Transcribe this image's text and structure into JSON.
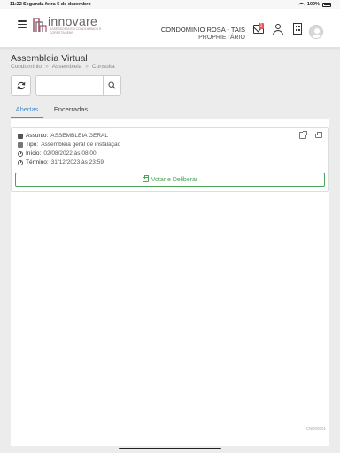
{
  "status_bar": {
    "time": "11:22",
    "date": "Segunda-feira 5 de dezembro",
    "battery": "100%"
  },
  "header": {
    "logo_text": "innovare",
    "logo_tagline": "ASSESSORIA EM CONDOMÍNIOS E CORRETAGENS",
    "condo_name": "CONDOMINIO ROSA - TAIS",
    "role": "PROPRIETÁRIO",
    "mail_badge": "1"
  },
  "page": {
    "title": "Assembleia Virtual",
    "breadcrumb": [
      "Condomínio",
      "Assembleia",
      "Consulta"
    ]
  },
  "search": {
    "value": "",
    "placeholder": ""
  },
  "tabs": [
    {
      "label": "Abertas",
      "active": true
    },
    {
      "label": "Encerradas",
      "active": false
    }
  ],
  "cards": [
    {
      "assunto_label": "Assunto:",
      "assunto": "ASSEMBLEIA GERAL",
      "tipo_label": "Tipo:",
      "tipo": "Assembleia geral de instalação",
      "inicio_label": "Início:",
      "inicio": "02/08/2022 às 08:00",
      "termino_label": "Término:",
      "termino": "31/12/2023 às 23:59",
      "vote_label": "Votar e Deliberar"
    }
  ],
  "footer_code": "CND00001",
  "colors": {
    "accent_blue": "#4a8fd0",
    "accent_green": "#4aa55a",
    "badge_red": "#e05a5a"
  }
}
